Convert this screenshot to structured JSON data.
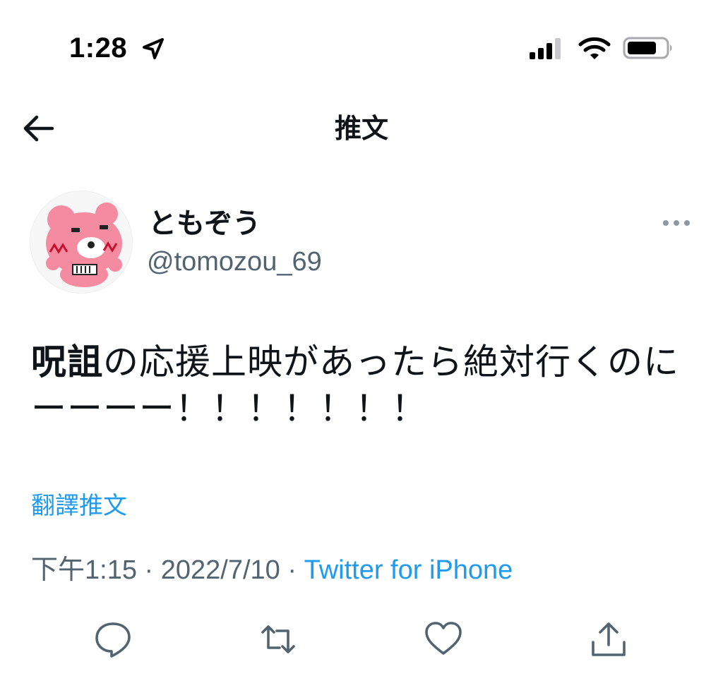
{
  "status_bar": {
    "time": "1:28"
  },
  "header": {
    "title": "推文"
  },
  "author": {
    "display_name": "ともぞう",
    "handle": "@tomozou_69"
  },
  "tweet": {
    "text_bold": "呪詛",
    "text_rest": "の応援上映があったら絶対行くのにーーーー！！！！！！！",
    "translate_label": "翻譯推文",
    "time": "下午1:15",
    "separator": "·",
    "date": "2022/7/10",
    "source": "Twitter for iPhone"
  },
  "actions": {
    "reply_icon": "reply-icon",
    "retweet_icon": "retweet-icon",
    "like_icon": "heart-icon",
    "share_icon": "share-icon"
  },
  "colors": {
    "link": "#1d9bf0",
    "secondary_text": "#536471",
    "primary_text": "#0f1419",
    "avatar_pink": "#f48ba0"
  }
}
